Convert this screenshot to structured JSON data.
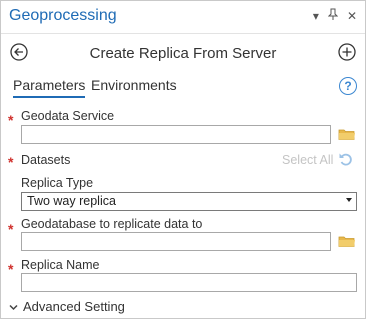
{
  "pane": {
    "title": "Geoprocessing",
    "controls": {
      "dropdown_glyph": "▾",
      "pin_glyph": "⊥",
      "close_glyph": "✕"
    }
  },
  "tool": {
    "back_icon": "back-arrow-circle-icon",
    "title": "Create Replica From Server",
    "add_icon": "plus-circle-icon"
  },
  "tabs": [
    {
      "label": "Parameters",
      "active": true
    },
    {
      "label": "Environments",
      "active": false
    }
  ],
  "help": {
    "glyph": "?"
  },
  "params": {
    "geodata_service": {
      "label": "Geodata Service",
      "required": true,
      "value": ""
    },
    "datasets": {
      "label": "Datasets",
      "required": true,
      "select_all": "Select All"
    },
    "replica_type": {
      "label": "Replica Type",
      "value": "Two way replica"
    },
    "geodatabase": {
      "label": "Geodatabase to replicate data to",
      "required": true,
      "value": ""
    },
    "replica_name": {
      "label": "Replica Name",
      "required": true,
      "value": ""
    }
  },
  "required_marker": "*",
  "advanced": {
    "label": "Advanced Setting",
    "chevron": "❯"
  },
  "colors": {
    "accent": "#1f6bb5",
    "required": "#d0312d",
    "folder": "#e8b84b",
    "disabled": "#c4c4c4"
  }
}
